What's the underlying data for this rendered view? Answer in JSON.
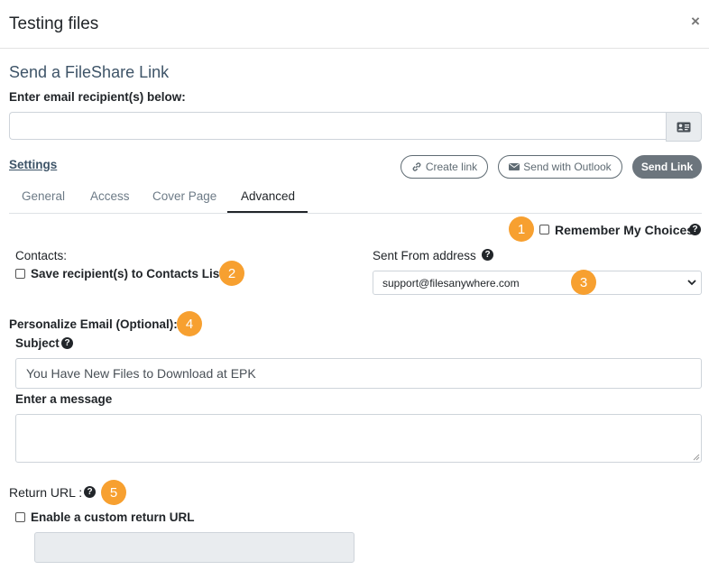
{
  "dialog": {
    "title": "Testing files",
    "close": "×"
  },
  "section": {
    "title": "Send a FileShare Link",
    "recipients_label": "Enter email recipient(s) below:",
    "recipients_value": "",
    "settings_label": "Settings"
  },
  "actions": {
    "create_link": "Create link",
    "send_outlook": "Send with Outlook",
    "send_link": "Send Link"
  },
  "tabs": [
    {
      "label": "General"
    },
    {
      "label": "Access"
    },
    {
      "label": "Cover Page"
    },
    {
      "label": "Advanced",
      "active": true
    }
  ],
  "advanced": {
    "remember_label": "Remember My Choices",
    "contacts_label": "Contacts:",
    "save_contacts_label": "Save recipient(s) to Contacts List",
    "sent_from_label": "Sent From address",
    "sent_from_value": "support@filesanywhere.com",
    "personalize_label": "Personalize Email (Optional):",
    "subject_label": "Subject",
    "subject_value": "You Have New Files to Download at EPK",
    "message_label": "Enter a message",
    "message_value": "",
    "return_url_label": "Return URL :",
    "enable_return_label": "Enable a custom return URL"
  },
  "badges": [
    "1",
    "2",
    "3",
    "4",
    "5"
  ],
  "icons": {
    "close": "close-icon",
    "contact_card": "contact-card-icon",
    "link": "link-icon",
    "envelope": "envelope-icon",
    "help": "question-circle-icon",
    "chevron": "chevron-down-icon"
  },
  "colors": {
    "accent_badge": "#f7a030",
    "heading": "#3e5468",
    "dark_button": "#6c757d"
  }
}
